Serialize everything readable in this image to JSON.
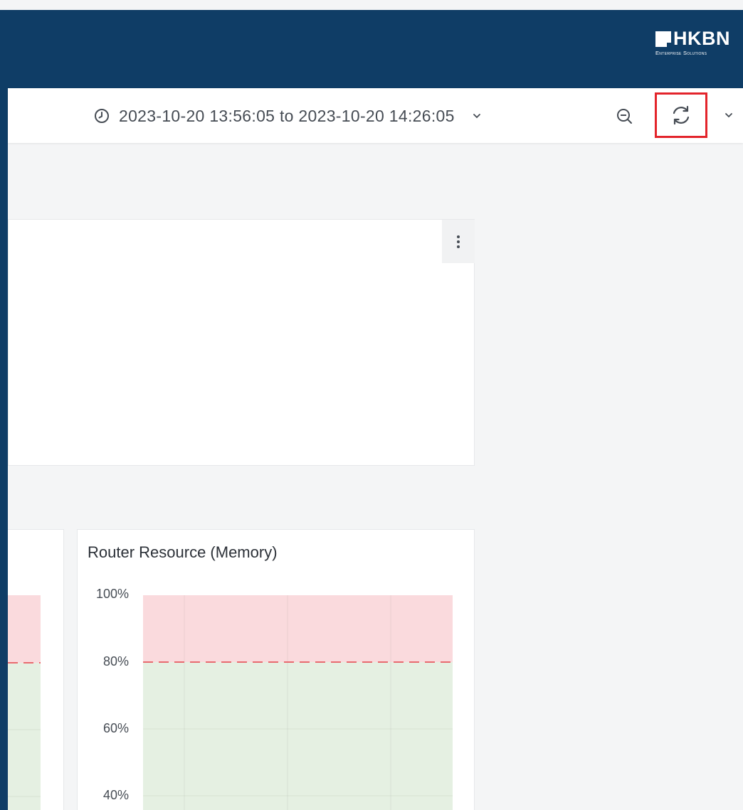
{
  "header": {
    "logo": {
      "brand": "HKBN",
      "tagline": "Enterprise Solutions"
    }
  },
  "toolbar": {
    "time_range": "2023-10-20 13:56:05 to 2023-10-20 14:26:05",
    "icons": {
      "clock": "clock-icon",
      "time_dropdown": "chevron-down-icon",
      "zoom_out": "zoom-out-icon",
      "refresh": "refresh-icon",
      "refresh_dropdown": "chevron-down-icon"
    },
    "highlight_color": "#e3242b"
  },
  "panels": {
    "top_panel": {
      "menu_icon": "kebab-menu-icon"
    },
    "memory_panel": {
      "title": "Router Resource (Memory)",
      "y_ticks": [
        "100%",
        "80%",
        "60%",
        "40%"
      ]
    }
  },
  "chart_data": {
    "type": "area",
    "title": "Router Resource (Memory)",
    "y_ticks": [
      "100%",
      "80%",
      "60%",
      "40%"
    ],
    "threshold": 80,
    "threshold_style": "dashed",
    "zones": [
      {
        "from": 80,
        "to": 100,
        "color": "#fadadd"
      },
      {
        "from": 0,
        "to": 80,
        "color": "#e5f0e2"
      }
    ],
    "grid": true
  },
  "colors": {
    "header_bg": "#0f3d66",
    "page_bg": "#f4f5f6",
    "danger_zone": "#fadadd",
    "ok_zone": "#e5f0e2",
    "threshold_line": "#e86a6f"
  }
}
